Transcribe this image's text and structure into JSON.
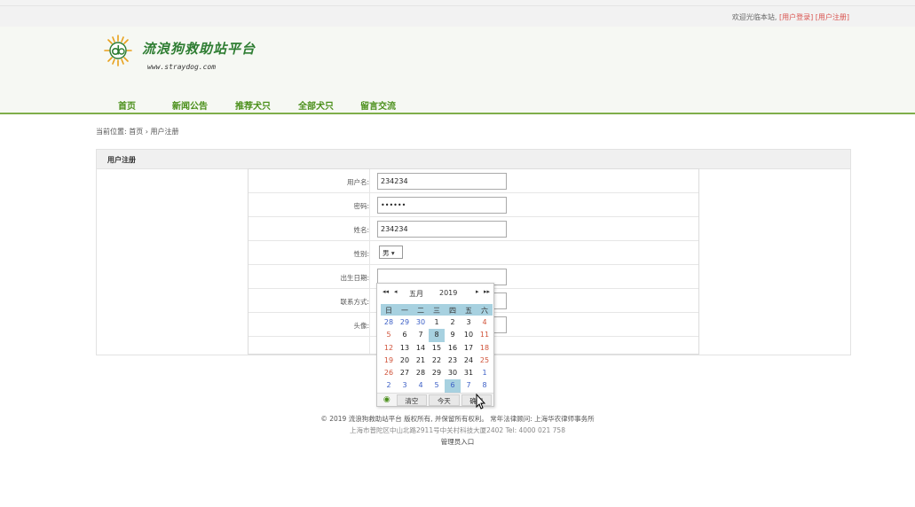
{
  "topbar": {
    "welcome": "欢迎光临本站,",
    "login_link": "[用户登录]",
    "register_link": "[用户注册]"
  },
  "site": {
    "title": "流浪狗救助站平台",
    "url": "www.straydog.com"
  },
  "nav": {
    "items": [
      "首页",
      "新闻公告",
      "推荐犬只",
      "全部犬只",
      "留言交流"
    ]
  },
  "breadcrumb": {
    "prefix": "当前位置:",
    "home": "首页",
    "separator": "›",
    "current": "用户注册"
  },
  "panel": {
    "title": "用户注册"
  },
  "form": {
    "username_label": "用户名:",
    "username_value": "234234",
    "password_label": "密码:",
    "password_value": "••••••",
    "name_label": "姓名:",
    "name_value": "234234",
    "gender_label": "性别:",
    "gender_value": "男 ▾",
    "birthdate_label": "出生日期:",
    "birthdate_value": "",
    "contact_label": "联系方式:",
    "avatar_label": "头像:"
  },
  "calendar": {
    "prev_year": "◂◂",
    "prev_month": "◂",
    "month": "五月",
    "year": "2019",
    "next_month": "▸",
    "next_year": "▸▸",
    "weekdays": [
      "日",
      "一",
      "二",
      "三",
      "四",
      "五",
      "六"
    ],
    "weeks": [
      [
        "28",
        "29",
        "30",
        "1",
        "2",
        "3",
        "4"
      ],
      [
        "5",
        "6",
        "7",
        "8",
        "9",
        "10",
        "11"
      ],
      [
        "12",
        "13",
        "14",
        "15",
        "16",
        "17",
        "18"
      ],
      [
        "19",
        "20",
        "21",
        "22",
        "23",
        "24",
        "25"
      ],
      [
        "26",
        "27",
        "28",
        "29",
        "30",
        "31",
        "1"
      ],
      [
        "2",
        "3",
        "4",
        "5",
        "6",
        "7",
        "8"
      ]
    ],
    "clear_label": "清空",
    "today_label": "今天",
    "confirm_label": "确定",
    "colors": {
      "header_bg": "#a7d1e0",
      "other_month": "#3c5fc6",
      "weekend": "#d0533a",
      "current_month": "#222222"
    }
  },
  "footer": {
    "copyright": "© 2019 流浪狗救助站平台 版权所有, 并保留所有权利。 常年法律顾问: 上海华农律师事务所",
    "address": "上海市普陀区中山北路2911号中关村科技大厦2402 Tel: 4000 021 758",
    "admin_link": "管理员入口"
  },
  "colors": {
    "brand_green": "#4a8f1a",
    "nav_line": "#7fae4a",
    "link_red": "#d9534f"
  }
}
